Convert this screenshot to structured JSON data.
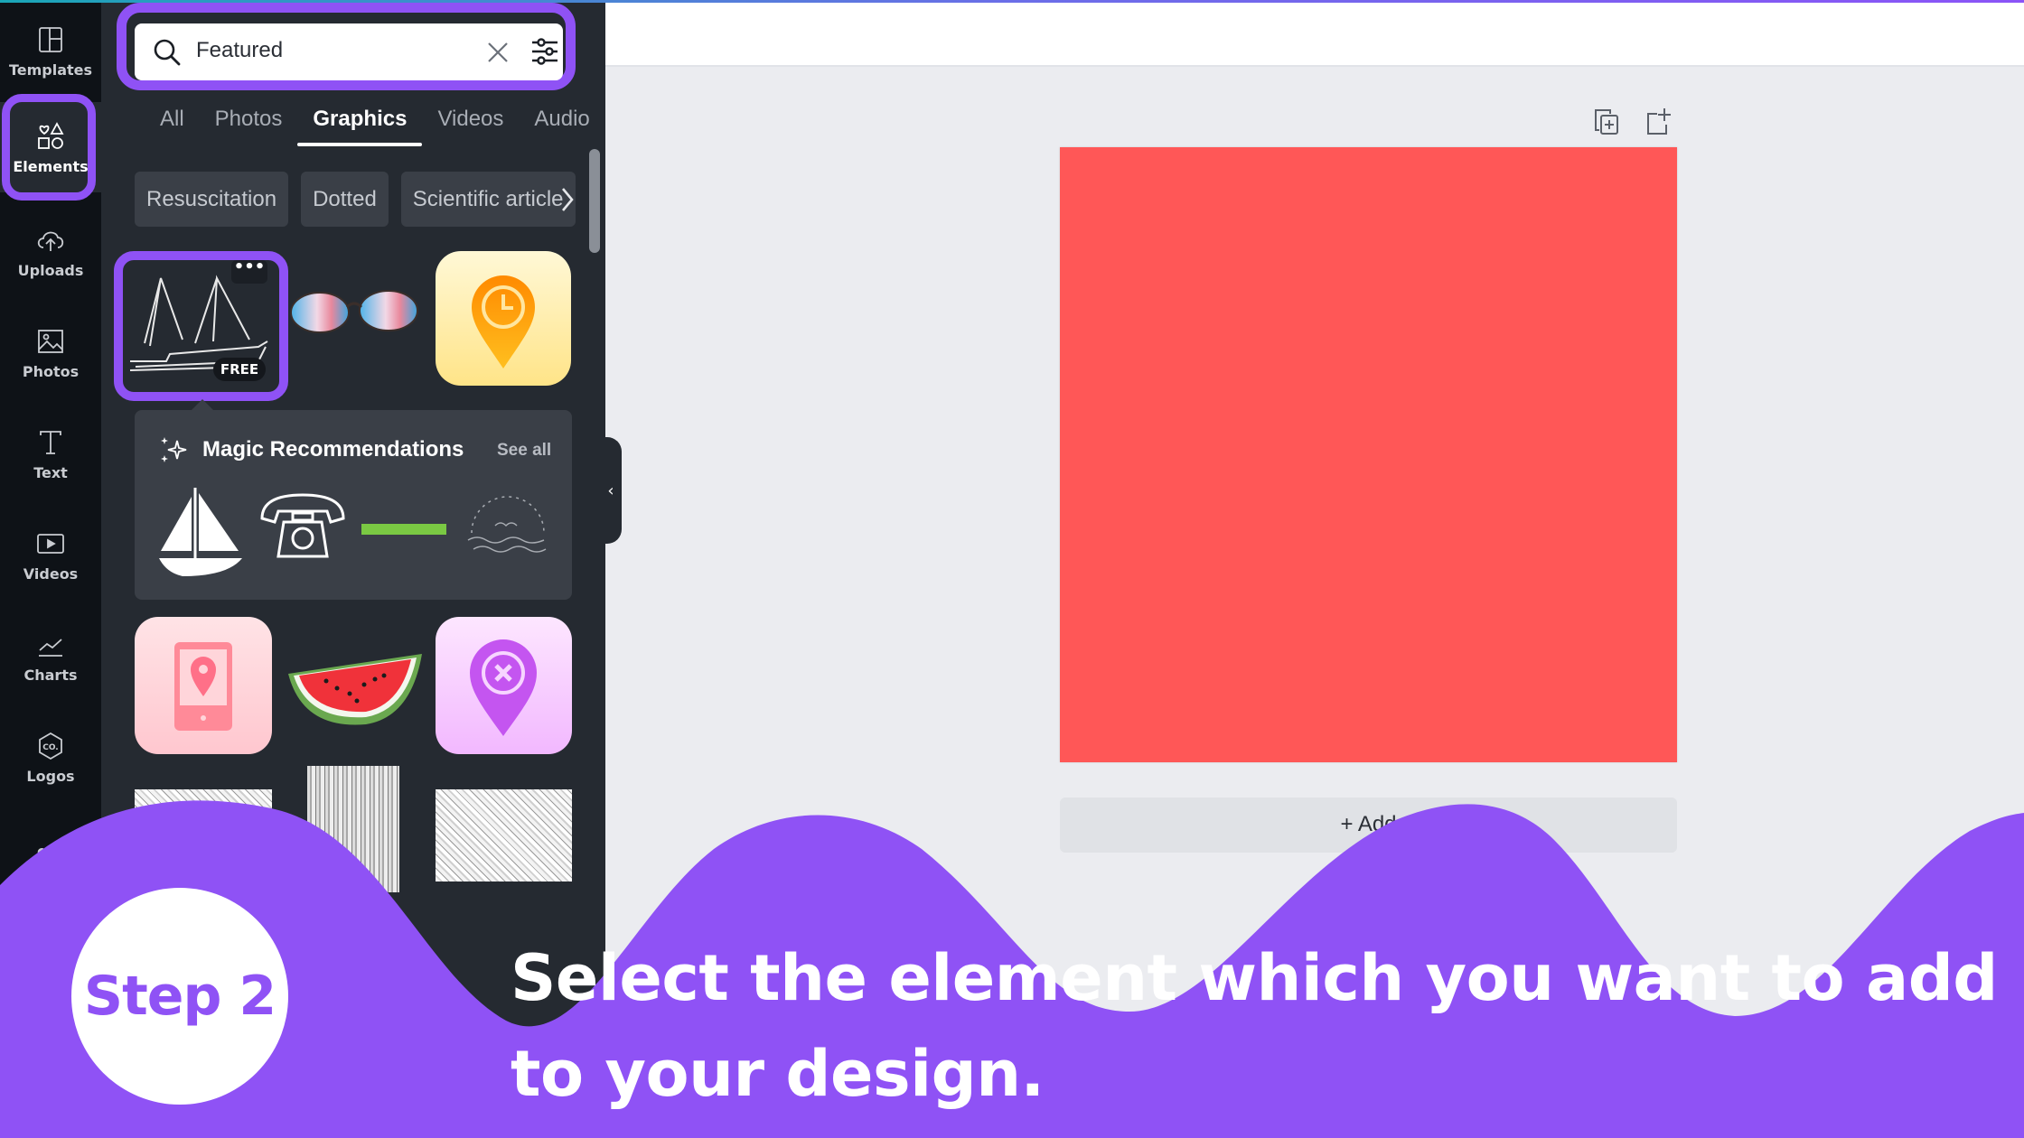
{
  "app": {
    "accent_color": "#8f52f5",
    "page_color": "#ff5757"
  },
  "nav": {
    "items": [
      {
        "label": "Templates",
        "icon": "templates-icon",
        "active": false
      },
      {
        "label": "Elements",
        "icon": "elements-icon",
        "active": true
      },
      {
        "label": "Uploads",
        "icon": "upload-cloud-icon",
        "active": false
      },
      {
        "label": "Photos",
        "icon": "image-icon",
        "active": false
      },
      {
        "label": "Text",
        "icon": "text-icon",
        "active": false
      },
      {
        "label": "Videos",
        "icon": "video-play-icon",
        "active": false
      },
      {
        "label": "Charts",
        "icon": "line-chart-icon",
        "active": false
      },
      {
        "label": "Logos",
        "icon": "logo-badge-icon",
        "active": false
      }
    ],
    "more": "•••"
  },
  "search": {
    "value": "Featured"
  },
  "tabs": [
    {
      "label": "All",
      "active": false
    },
    {
      "label": "Photos",
      "active": false
    },
    {
      "label": "Graphics",
      "active": true
    },
    {
      "label": "Videos",
      "active": false
    },
    {
      "label": "Audio",
      "active": false
    }
  ],
  "chips": [
    "Resuscitation",
    "Dotted",
    "Scientific article"
  ],
  "grid": {
    "selected_badge": "FREE",
    "more_options": "•••",
    "row1": [
      "sailing-ship-outline",
      "watercolor-glasses",
      "clock-location-pin"
    ],
    "row2": [
      "phone-location-pin",
      "watermelon-slice",
      "cancel-location-pin"
    ],
    "row3": [
      "grunge-texture",
      "wood-texture",
      "marble-texture"
    ]
  },
  "magic": {
    "title": "Magic Recommendations",
    "see_all": "See all",
    "items": [
      "sailboat",
      "rotary-telephone",
      "green-line",
      "sunset-birds"
    ]
  },
  "canvas": {
    "add_page_label": "+ Add"
  },
  "overlay": {
    "step": "Step 2",
    "instruction": "Select the element which you want to add to your design."
  }
}
